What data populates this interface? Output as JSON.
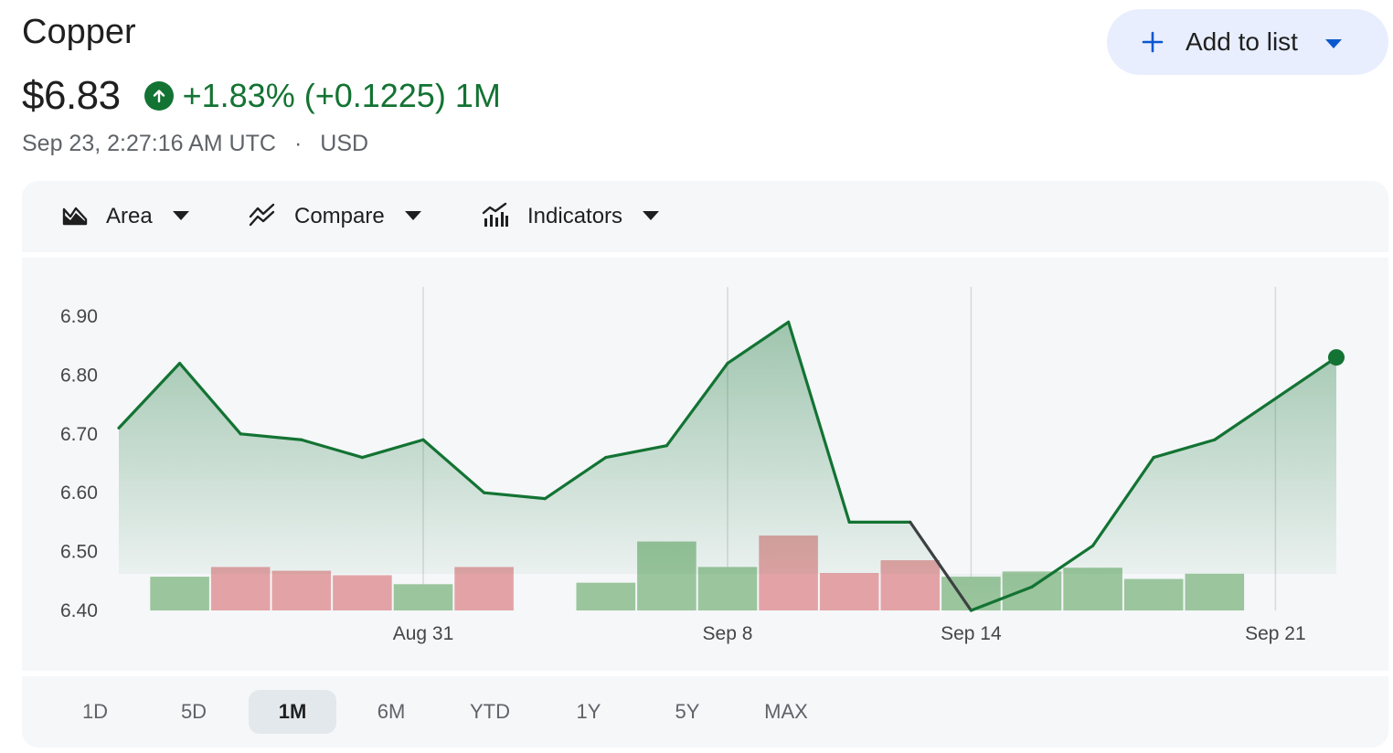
{
  "header": {
    "title": "Copper",
    "price": "$6.83",
    "change": "+1.83% (+0.1225) 1M",
    "timestamp": "Sep 23, 2:27:16 AM UTC",
    "separator": "·",
    "currency": "USD",
    "add_to_list_label": "Add to list"
  },
  "toolbar": {
    "area_label": "Area",
    "compare_label": "Compare",
    "indicators_label": "Indicators"
  },
  "ranges": [
    {
      "label": "1D",
      "active": false
    },
    {
      "label": "5D",
      "active": false
    },
    {
      "label": "1M",
      "active": true
    },
    {
      "label": "6M",
      "active": false
    },
    {
      "label": "YTD",
      "active": false
    },
    {
      "label": "1Y",
      "active": false
    },
    {
      "label": "5Y",
      "active": false
    },
    {
      "label": "MAX",
      "active": false
    }
  ],
  "colors": {
    "accent_up": "#137333",
    "line": "#137333",
    "line_down": "#3c4043",
    "volume_up": "#9bc59d",
    "volume_down": "#e3a3a6",
    "button_bg": "#e8eefd",
    "button_icon": "#0b57d0"
  },
  "chart_data": {
    "type": "area",
    "ylim": [
      6.4,
      6.9
    ],
    "yticks": [
      "6.90",
      "6.80",
      "6.70",
      "6.60",
      "6.50",
      "6.40"
    ],
    "xtick_labels": [
      "Aug 31",
      "Sep 8",
      "Sep 14",
      "Sep 21"
    ],
    "xtick_index": [
      5,
      10,
      14,
      19
    ],
    "grid_vertical": true,
    "series": [
      {
        "values": [
          6.71,
          6.82,
          6.7,
          6.69,
          6.66,
          6.69,
          6.6,
          6.59,
          6.66,
          6.68,
          6.82,
          6.89,
          6.55,
          6.55,
          6.4,
          6.44,
          6.51,
          6.66,
          6.69,
          6.76,
          6.83
        ]
      }
    ],
    "volume": [
      {
        "index": 1,
        "level": 0.45,
        "dir": "up"
      },
      {
        "index": 2,
        "level": 0.58,
        "dir": "down"
      },
      {
        "index": 3,
        "level": 0.53,
        "dir": "down"
      },
      {
        "index": 4,
        "level": 0.47,
        "dir": "down"
      },
      {
        "index": 5,
        "level": 0.35,
        "dir": "up"
      },
      {
        "index": 6,
        "level": 0.58,
        "dir": "down"
      },
      {
        "index": 8,
        "level": 0.37,
        "dir": "up"
      },
      {
        "index": 9,
        "level": 0.92,
        "dir": "up"
      },
      {
        "index": 10,
        "level": 0.58,
        "dir": "up"
      },
      {
        "index": 11,
        "level": 1.0,
        "dir": "down"
      },
      {
        "index": 12,
        "level": 0.5,
        "dir": "down"
      },
      {
        "index": 13,
        "level": 0.67,
        "dir": "down"
      },
      {
        "index": 14,
        "level": 0.45,
        "dir": "up"
      },
      {
        "index": 15,
        "level": 0.52,
        "dir": "up"
      },
      {
        "index": 16,
        "level": 0.57,
        "dir": "up"
      },
      {
        "index": 17,
        "level": 0.42,
        "dir": "up"
      },
      {
        "index": 18,
        "level": 0.49,
        "dir": "up"
      }
    ],
    "last_value": 6.83
  }
}
